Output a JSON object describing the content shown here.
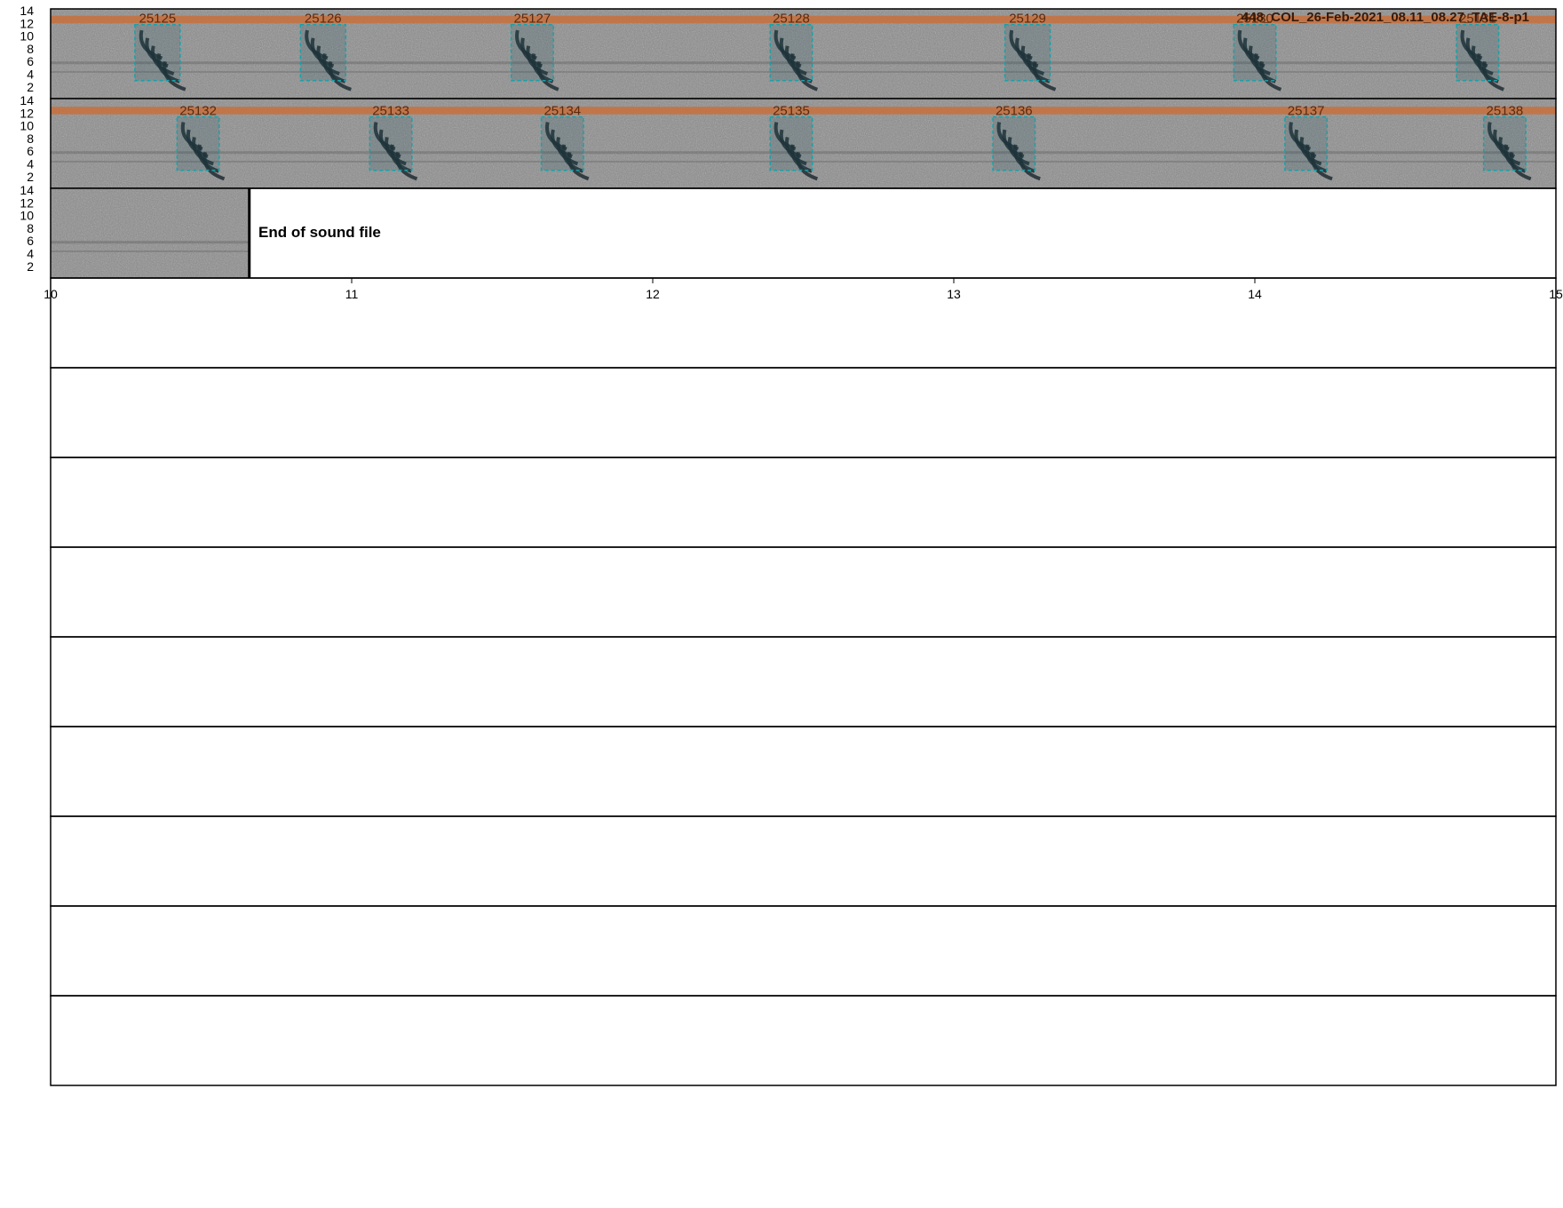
{
  "chart_data": {
    "type": "spectrogram",
    "file_title": "448_COL_26-Feb-2021_08.11_08.27_TAE-8-p1",
    "end_message": "End of sound file",
    "y_ticks": [
      2,
      4,
      6,
      8,
      10,
      12,
      14
    ],
    "y_range": [
      1,
      14
    ],
    "x_ticks": [
      10,
      11,
      12,
      13,
      14,
      15
    ],
    "x_range": [
      10,
      15
    ],
    "rows": [
      {
        "has_audio": true,
        "t_start": 0,
        "t_end": 5,
        "band": [
          12,
          13.2
        ],
        "calls": [
          {
            "id": "25125",
            "t0": 0.28,
            "t1": 0.43,
            "f0": 3,
            "f1": 11.8
          },
          {
            "id": "25126",
            "t0": 0.83,
            "t1": 0.98,
            "f0": 3,
            "f1": 11.8
          },
          {
            "id": "25127",
            "t0": 1.53,
            "t1": 1.67,
            "f0": 3,
            "f1": 11.8
          },
          {
            "id": "25128",
            "t0": 2.39,
            "t1": 2.53,
            "f0": 3,
            "f1": 11.8
          },
          {
            "id": "25129",
            "t0": 3.17,
            "t1": 3.32,
            "f0": 3,
            "f1": 11.8
          },
          {
            "id": "25130",
            "t0": 3.93,
            "t1": 4.07,
            "f0": 3,
            "f1": 11.8
          },
          {
            "id": "25131",
            "t0": 4.67,
            "t1": 4.81,
            "f0": 3,
            "f1": 11.8
          }
        ]
      },
      {
        "has_audio": true,
        "t_start": 5,
        "t_end": 10,
        "band": [
          11.8,
          13
        ],
        "calls": [
          {
            "id": "25132",
            "t0": 5.42,
            "t1": 5.56,
            "f0": 3,
            "f1": 11.4
          },
          {
            "id": "25133",
            "t0": 6.06,
            "t1": 6.2,
            "f0": 3,
            "f1": 11.4
          },
          {
            "id": "25134",
            "t0": 6.63,
            "t1": 6.77,
            "f0": 3,
            "f1": 11.4
          },
          {
            "id": "25135",
            "t0": 7.39,
            "t1": 7.53,
            "f0": 3,
            "f1": 11.4
          },
          {
            "id": "25136",
            "t0": 8.13,
            "t1": 8.27,
            "f0": 3,
            "f1": 11.4
          },
          {
            "id": "25137",
            "t0": 9.1,
            "t1": 9.24,
            "f0": 3,
            "f1": 11.4
          },
          {
            "id": "25138",
            "t0": 9.76,
            "t1": 9.9,
            "f0": 3,
            "f1": 11.4
          }
        ]
      },
      {
        "has_audio": true,
        "t_start": 10,
        "t_end": 15,
        "audio_end": 10.66,
        "calls": []
      },
      {
        "has_audio": false
      },
      {
        "has_audio": false
      },
      {
        "has_audio": false
      },
      {
        "has_audio": false
      },
      {
        "has_audio": false
      },
      {
        "has_audio": false
      },
      {
        "has_audio": false
      },
      {
        "has_audio": false
      },
      {
        "has_audio": false
      }
    ],
    "colors": {
      "band": "#c8703c",
      "box": "#1aa0a8",
      "call_label": "#5a2a10",
      "frame": "#000000"
    }
  }
}
